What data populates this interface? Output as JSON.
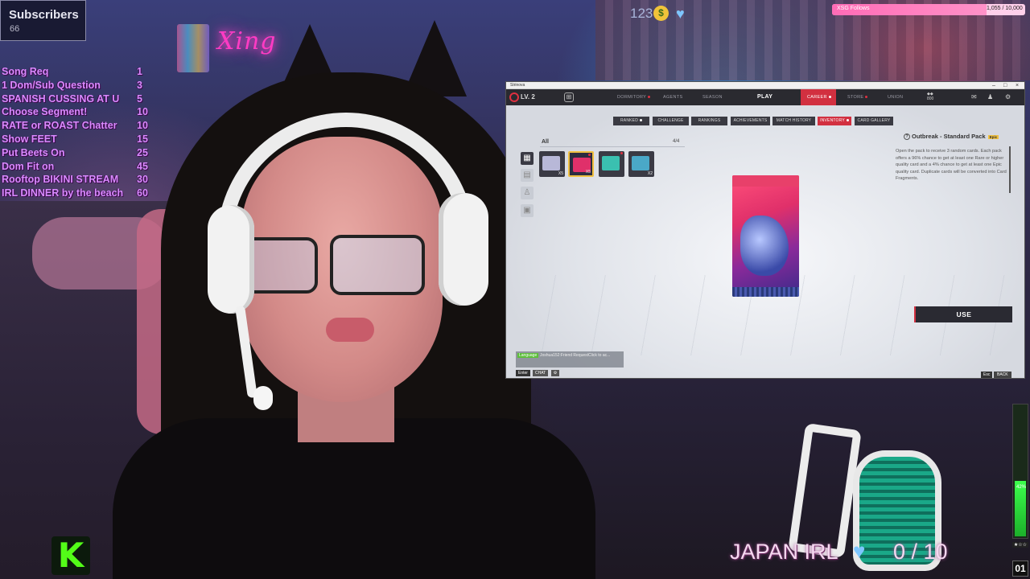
{
  "stream": {
    "subscribers_title": "Subscribers",
    "subscribers_count": "66",
    "sub_goal": "123",
    "follow_goal": {
      "label": "XSG Follows",
      "count": "1,055 / 10,000",
      "progress": 0.8
    },
    "menu": [
      {
        "label": "Song Req",
        "points": "1"
      },
      {
        "label": "1 Dom/Sub Question",
        "points": "3"
      },
      {
        "label": "SPANISH CUSSING AT U",
        "points": "5"
      },
      {
        "label": "Choose Segment!",
        "points": "10"
      },
      {
        "label": "RATE or ROAST Chatter",
        "points": "10"
      },
      {
        "label": "Show FEET",
        "points": "15"
      },
      {
        "label": "Put Beets On",
        "points": "25"
      },
      {
        "label": "Dom Fit on",
        "points": "45"
      },
      {
        "label": "Rooftop BIKINI STREAM",
        "points": "30"
      },
      {
        "label": "IRL DINNER by the beach",
        "points": "60"
      }
    ],
    "kick_logo": "K",
    "japan_label": "JAPAN IRL",
    "japan_count": "0 / 10",
    "meter_label": "42%",
    "meter_level": 0.42,
    "stars": "★☆☆",
    "counter": "01",
    "neon_sign": "Xing"
  },
  "game": {
    "window_title": "Strinova",
    "level": "LV. 2",
    "nav": {
      "dormitory": "DORMITORY",
      "agents": "AGENTS",
      "season": "SEASON",
      "play": "PLAY",
      "career": "CAREER",
      "store": "STORE",
      "union": "UNION",
      "currency": "800"
    },
    "tabs": {
      "ranked": "RANKED",
      "challenge": "CHALLENGE",
      "rankings": "RANKINGS",
      "achievements": "ACHIEVEMENTS",
      "match_history": "MATCH HISTORY",
      "inventory": "INVENTORY",
      "card_gallery": "CARD GALLERY"
    },
    "inventory": {
      "category": "All",
      "count": "4/4",
      "items": [
        {
          "qty": "X5",
          "color": "#b8b8d8"
        },
        {
          "qty": "X5",
          "color": "#e0306a"
        },
        {
          "qty": "",
          "color": "#3ac0b0"
        },
        {
          "qty": "X2",
          "color": "#4aa8c8"
        }
      ]
    },
    "pack": {
      "title": "Outbreak - Standard Pack",
      "badge": "Epic",
      "description": "Open the pack to receive 3 random cards. Each pack offers a 96% chance to get at least one Rare or higher quality card and a 4% chance to get at least one Epic quality card. Duplicate cards will be converted into Card Fragments.",
      "use_label": "USE"
    },
    "chat": {
      "language": "Language",
      "message": "Joshua152:Friend RequestClick to ac...",
      "enter": "Enter",
      "label": "CHAT"
    },
    "esc": "Esc",
    "back": "BACK"
  }
}
